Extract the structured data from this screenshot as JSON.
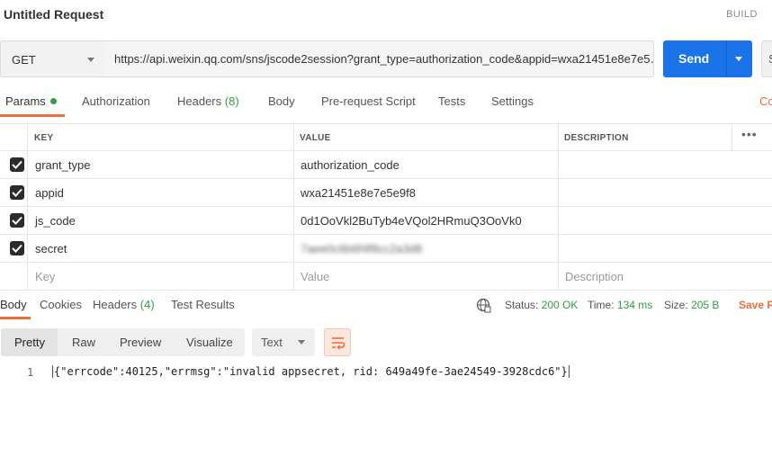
{
  "window": {
    "title": "Untitled Request",
    "build_label": "BUILD"
  },
  "request": {
    "method": "GET",
    "url": "https://api.weixin.qq.com/sns/jscode2session?grant_type=authorization_code&appid=wxa21451e8e7e5…",
    "send_label": "Send",
    "save_stub": "S"
  },
  "request_tabs": [
    {
      "label": "Params",
      "count": ""
    },
    {
      "label": "Authorization",
      "count": ""
    },
    {
      "label": "Headers",
      "count": "(8)"
    },
    {
      "label": "Body",
      "count": ""
    },
    {
      "label": "Pre-request Script",
      "count": ""
    },
    {
      "label": "Tests",
      "count": ""
    },
    {
      "label": "Settings",
      "count": ""
    }
  ],
  "cookies_link": "Co",
  "params_table": {
    "headers": {
      "key": "KEY",
      "value": "VALUE",
      "description": "DESCRIPTION"
    },
    "rows": [
      {
        "checked": true,
        "key": "grant_type",
        "value": "authorization_code",
        "description": ""
      },
      {
        "checked": true,
        "key": "appid",
        "value": "wxa21451e8e7e5e9f8",
        "description": ""
      },
      {
        "checked": true,
        "key": "js_code",
        "value": "0d1OoVkl2BuTyb4eVQol2HRmuQ3OoVk0",
        "description": ""
      },
      {
        "checked": true,
        "key": "secret",
        "value": "7aee0c6b6f4f8cc2a3d8",
        "description": ""
      }
    ],
    "placeholders": {
      "key": "Key",
      "value": "Value",
      "description": "Description"
    }
  },
  "response_tabs": [
    {
      "label": "Body",
      "count": ""
    },
    {
      "label": "Cookies",
      "count": ""
    },
    {
      "label": "Headers",
      "count": "(4)"
    },
    {
      "label": "Test Results",
      "count": ""
    }
  ],
  "response_status": {
    "status_label": "Status:",
    "status_value": "200 OK",
    "time_label": "Time:",
    "time_value": "134 ms",
    "size_label": "Size:",
    "size_value": "205 B",
    "save_response": "Save R"
  },
  "view_tabs": [
    "Pretty",
    "Raw",
    "Preview",
    "Visualize"
  ],
  "format": "Text",
  "response_body": {
    "line_number": "1",
    "text": "{\"errcode\":40125,\"errmsg\":\"invalid appsecret, rid: 649a49fe-3ae24549-3928cdc6\"}"
  },
  "colors": {
    "accent": "#f26b3a",
    "send": "#1a73e8",
    "success": "#2f9e44"
  },
  "icons": [
    "chevron-down-icon",
    "checkbox-checked-icon",
    "more-horizontal-icon",
    "globe-icon",
    "wrap-lines-icon"
  ]
}
